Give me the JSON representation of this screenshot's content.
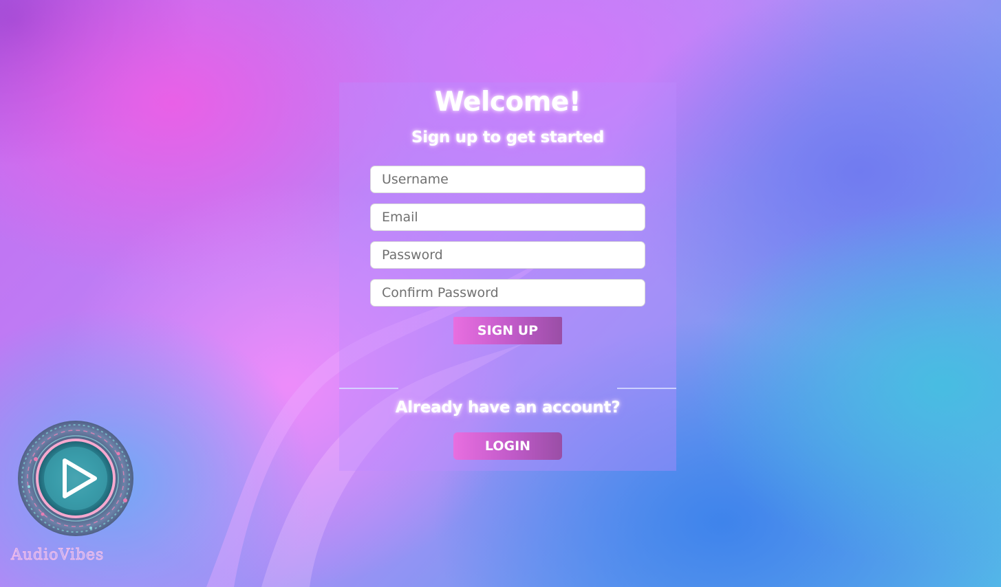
{
  "signup_panel": {
    "title": "Welcome!",
    "subtitle": "Sign up to get started",
    "fields": {
      "username_placeholder": "Username",
      "email_placeholder": "Email",
      "password_placeholder": "Password",
      "confirm_password_placeholder": "Confirm Password"
    },
    "signup_button_label": "SIGN UP",
    "login_prompt": "Already have an account?",
    "login_button_label": "LOGIN"
  },
  "brand": {
    "logo_icon": "play-icon",
    "name": "AudioVibes"
  },
  "colors": {
    "button_gradient_start": "#e86ee0",
    "button_gradient_end": "#9a4ea6",
    "panel_tint": "#be8cff",
    "background_pink": "#eb5fe6",
    "background_blue": "#3c82eb"
  }
}
